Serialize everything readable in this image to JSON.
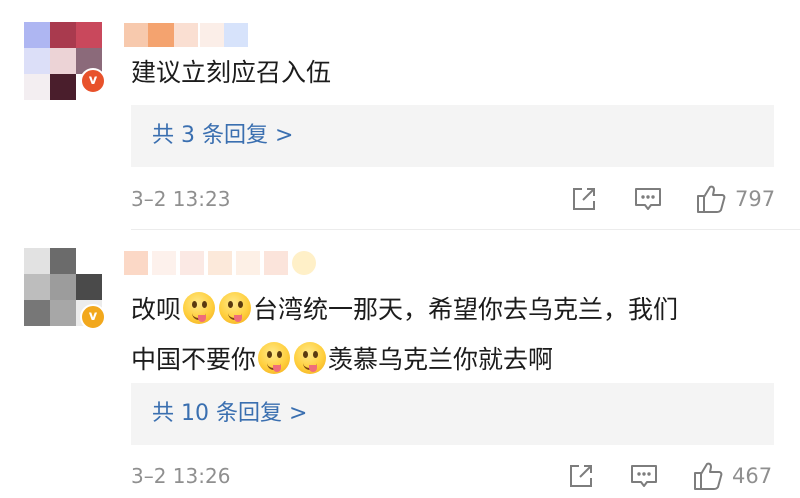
{
  "comments": [
    {
      "text": "建议立刻应召入伍",
      "reply_link": "共 3 条回复 >",
      "timestamp": "3–2 13:23",
      "likes": "797",
      "verified_icon": "verified-v-icon",
      "colors": {
        "badge": "#e8522b"
      }
    },
    {
      "text_segments": [
        "改呗",
        "台湾统一那天，希望你去乌克兰，我们",
        "中国不要你",
        "羡慕乌克兰你就去啊"
      ],
      "emoji_name": "smirk-tongue-emoji",
      "reply_link": "共 10 条回复 >",
      "timestamp": "3–2 13:26",
      "likes": "467",
      "verified_icon": "verified-v-icon",
      "colors": {
        "badge": "#f2a81d"
      }
    }
  ],
  "icons": {
    "share": "share-icon",
    "comment": "comment-icon",
    "like": "thumbs-up-icon"
  },
  "badge_letter": "v",
  "colors": {
    "link": "#3a6fb0",
    "meta_text": "#8f8f8f",
    "reply_box_bg": "#f4f4f4"
  }
}
